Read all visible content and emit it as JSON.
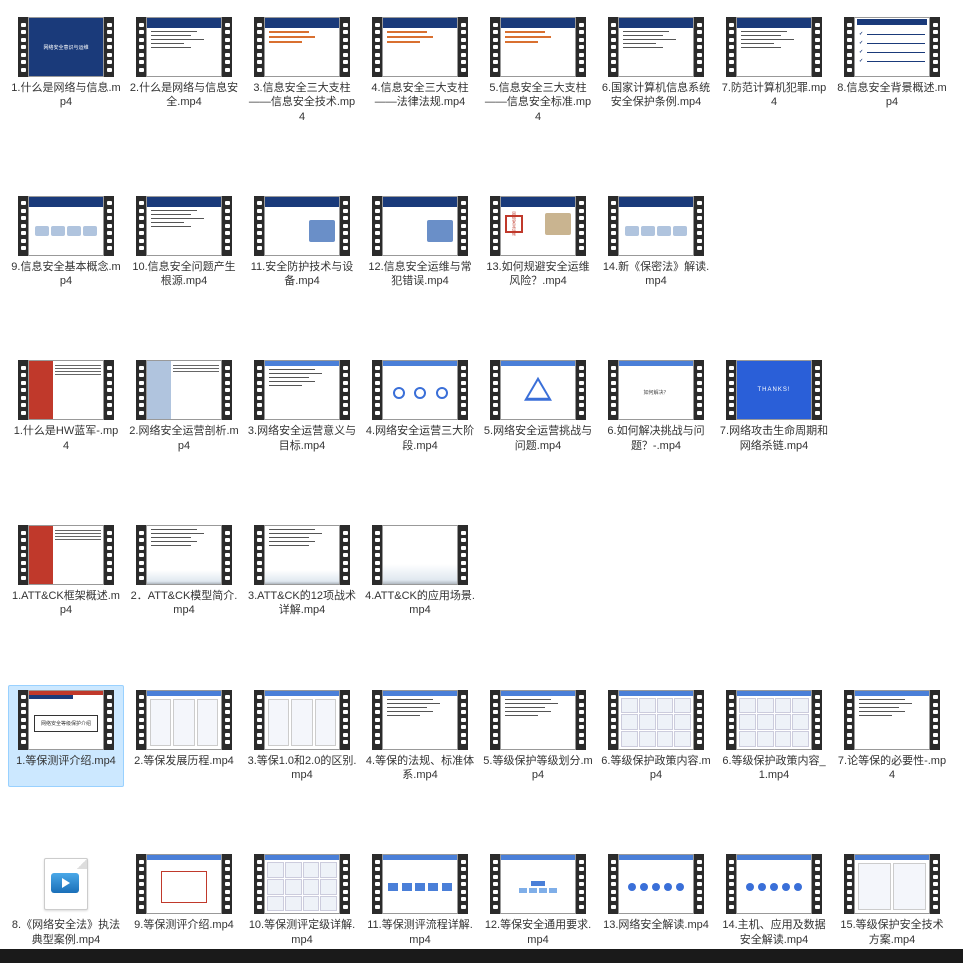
{
  "rows": [
    {
      "items": [
        {
          "label": "1.什么是网络与信息.mp4",
          "thumb": "title_blue",
          "selected": false
        },
        {
          "label": "2.什么是网络与信息安全.mp4",
          "thumb": "hdr_lines",
          "selected": false
        },
        {
          "label": "3.信息安全三大支柱——信息安全技术.mp4",
          "thumb": "hdr_orange",
          "selected": false
        },
        {
          "label": "4.信息安全三大支柱——法律法规.mp4",
          "thumb": "hdr_orange",
          "selected": false
        },
        {
          "label": "5.信息安全三大支柱——信息安全标准.mp4",
          "thumb": "hdr_orange",
          "selected": false
        },
        {
          "label": "6.国家计算机信息系统安全保护条例.mp4",
          "thumb": "hdr_lines",
          "selected": false
        },
        {
          "label": "7.防范计算机犯罪.mp4",
          "thumb": "hdr_lines",
          "selected": false
        },
        {
          "label": "8.信息安全背景概述.mp4",
          "thumb": "checks",
          "selected": false
        }
      ]
    },
    {
      "items": [
        {
          "label": "9.信息安全基本概念.mp4",
          "thumb": "hdr_img",
          "selected": false
        },
        {
          "label": "10.信息安全问题产生根源.mp4",
          "thumb": "hdr_lines",
          "selected": false
        },
        {
          "label": "11.安全防护技术与设备.mp4",
          "thumb": "hdr_img2",
          "selected": false
        },
        {
          "label": "12.信息安全运维与常犯错误.mp4",
          "thumb": "hdr_img2",
          "selected": false
        },
        {
          "label": "13.如何规避安全运维风险？.mp4",
          "thumb": "red_box",
          "selected": false
        },
        {
          "label": "14.新《保密法》解读.mp4",
          "thumb": "hdr_img",
          "selected": false
        }
      ]
    },
    {
      "items": [
        {
          "label": "1.什么是HW蓝军-.mp4",
          "thumb": "two_col",
          "selected": false
        },
        {
          "label": "2.网络安全运营剖析.mp4",
          "thumb": "two_col2",
          "selected": false
        },
        {
          "label": "3.网络安全运营意义与目标.mp4",
          "thumb": "hdr_lines_lt",
          "selected": false
        },
        {
          "label": "4.网络安全运营三大阶段.mp4",
          "thumb": "circles",
          "selected": false
        },
        {
          "label": "5.网络安全运营挑战与问题.mp4",
          "thumb": "triangle",
          "selected": false
        },
        {
          "label": "6.如何解决挑战与问题？-.mp4",
          "thumb": "center_txt",
          "selected": false
        },
        {
          "label": "7.网络攻击生命周期和网络杀链.mp4",
          "thumb": "thanks",
          "selected": false
        }
      ]
    },
    {
      "items": [
        {
          "label": "1.ATT&CK框架概述.mp4",
          "thumb": "two_col",
          "selected": false
        },
        {
          "label": "2．ATT&CK模型简介.mp4",
          "thumb": "sky_lines",
          "selected": false
        },
        {
          "label": "3.ATT&CK的12项战术详解.mp4",
          "thumb": "sky_lines",
          "selected": false
        },
        {
          "label": "4.ATT&CK的应用场景.mp4",
          "thumb": "sky",
          "selected": false
        }
      ]
    },
    {
      "items": [
        {
          "label": "1.等保测评介绍.mp4",
          "thumb": "title_frame",
          "selected": true
        },
        {
          "label": "2.等保发展历程.mp4",
          "thumb": "cols3",
          "selected": false
        },
        {
          "label": "3.等保1.0和2.0的区别.mp4",
          "thumb": "cols3",
          "selected": false
        },
        {
          "label": "4.等保的法规、标准体系.mp4",
          "thumb": "hdr_lines_lt",
          "selected": false
        },
        {
          "label": "5.等级保护等级划分.mp4",
          "thumb": "hdr_lines_lt",
          "selected": false
        },
        {
          "label": "6.等级保护政策内容.mp4",
          "thumb": "table",
          "selected": false
        },
        {
          "label": "6.等级保护政策内容_1.mp4",
          "thumb": "table",
          "selected": false
        },
        {
          "label": "7.论等保的必要性-.mp4",
          "thumb": "hdr_lines_lt",
          "selected": false
        }
      ]
    },
    {
      "items": [
        {
          "label": "8.《网络安全法》执法典型案例.mp4",
          "thumb": "wmv",
          "selected": false
        },
        {
          "label": "9.等保测评介绍.mp4",
          "thumb": "hdr_lines_box",
          "selected": false
        },
        {
          "label": "10.等保测评定级详解.mp4",
          "thumb": "table",
          "selected": false
        },
        {
          "label": "11.等保测评流程详解.mp4",
          "thumb": "flow",
          "selected": false
        },
        {
          "label": "12.等保安全通用要求.mp4",
          "thumb": "tree",
          "selected": false
        },
        {
          "label": "13.网络安全解读.mp4",
          "thumb": "diagram",
          "selected": false
        },
        {
          "label": "14.主机、应用及数据安全解读.mp4",
          "thumb": "diagram",
          "selected": false
        },
        {
          "label": "15.等级保护安全技术方案.mp4",
          "thumb": "diagram2",
          "selected": false
        }
      ]
    }
  ],
  "thumb_text": {
    "title_blue": "网络安全意识与运维",
    "title_frame": "网络安全等级保护介绍",
    "center_txt": "如何解决？",
    "thanks": "THANKS!",
    "red_box": "网络安全运维"
  }
}
